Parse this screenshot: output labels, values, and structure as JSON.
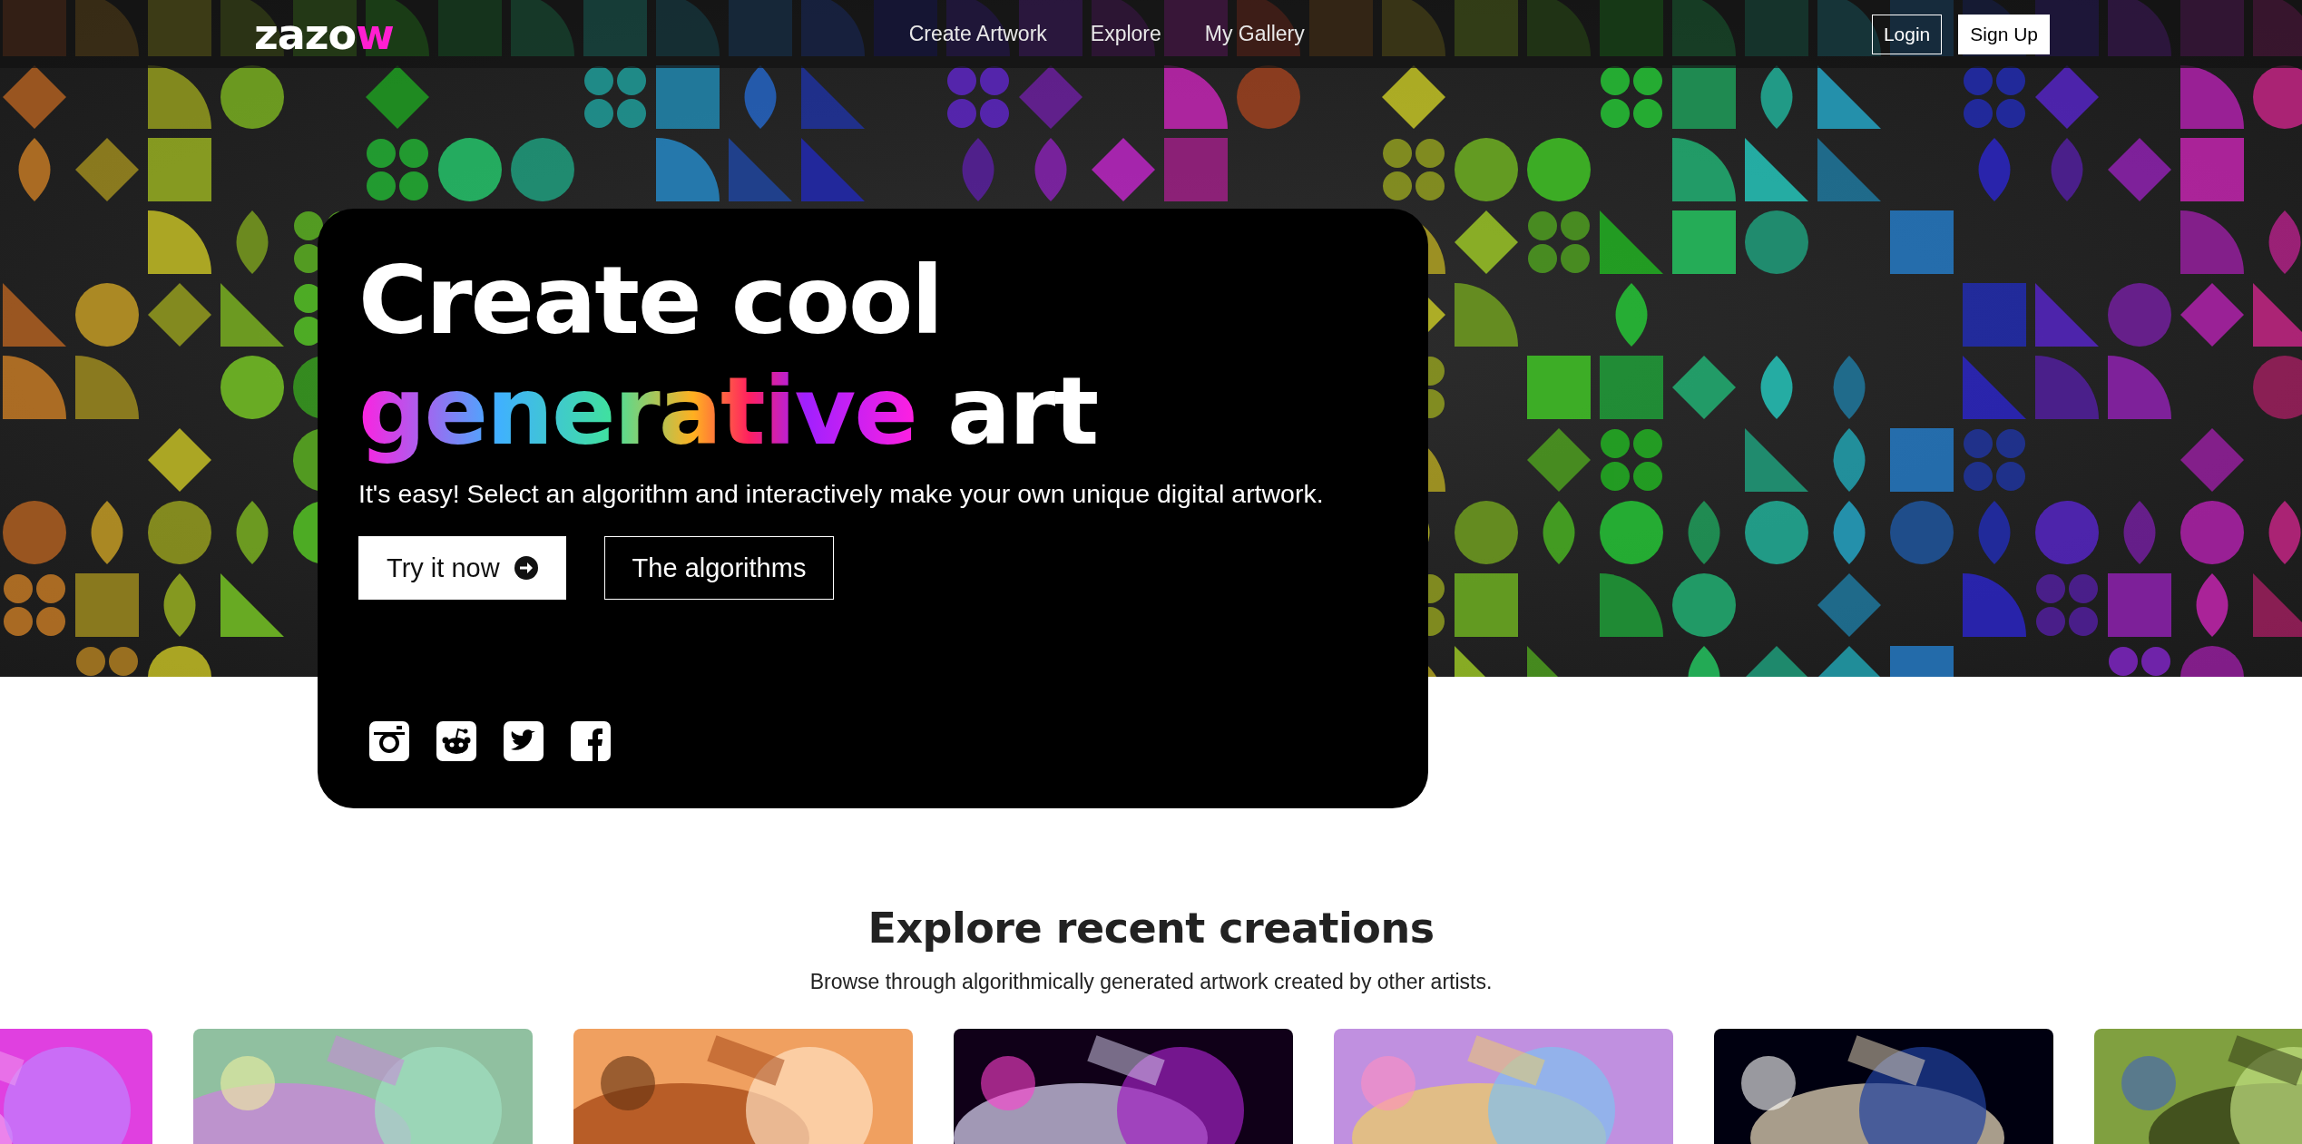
{
  "nav": {
    "logo": {
      "text": "zazo",
      "accent": "w"
    },
    "links": [
      "Create Artwork",
      "Explore",
      "My Gallery"
    ],
    "buttons": [
      {
        "label": "Login",
        "kind": "outline"
      },
      {
        "label": "Sign Up",
        "kind": "solid"
      }
    ]
  },
  "hero": {
    "title_line1": "Create cool",
    "title_highlight": "generative",
    "title_rest": "art",
    "subtitle": "It's easy! Select an algorithm and interactively make your own unique digital artwork.",
    "buttons": [
      {
        "label": "Try it now",
        "kind": "solid"
      },
      {
        "label": "The algorithms",
        "kind": "outline"
      }
    ]
  },
  "explore": {
    "title": "Explore recent creations",
    "subtitle": "Browse through algorithmically generated artwork created by other artists."
  }
}
